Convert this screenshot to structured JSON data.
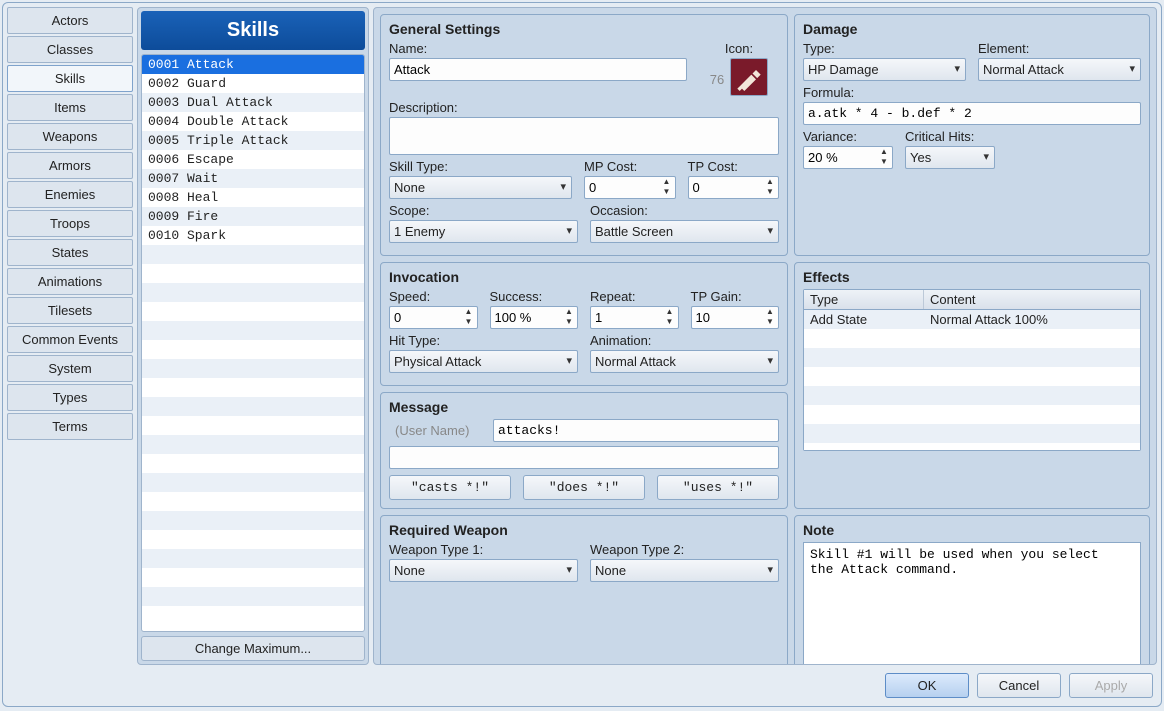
{
  "tabs": [
    "Actors",
    "Classes",
    "Skills",
    "Items",
    "Weapons",
    "Armors",
    "Enemies",
    "Troops",
    "States",
    "Animations",
    "Tilesets",
    "Common Events",
    "System",
    "Types",
    "Terms"
  ],
  "active_tab": 2,
  "list_header": "Skills",
  "skills": [
    "0001 Attack",
    "0002 Guard",
    "0003 Dual Attack",
    "0004 Double Attack",
    "0005 Triple Attack",
    "0006 Escape",
    "0007 Wait",
    "0008 Heal",
    "0009 Fire",
    "0010 Spark"
  ],
  "selected_skill": 0,
  "change_max": "Change Maximum...",
  "general": {
    "title": "General Settings",
    "name_label": "Name:",
    "name": "Attack",
    "icon_label": "Icon:",
    "icon_index": "76",
    "desc_label": "Description:",
    "desc": "",
    "skill_type_label": "Skill Type:",
    "skill_type": "None",
    "mp_cost_label": "MP Cost:",
    "mp_cost": "0",
    "tp_cost_label": "TP Cost:",
    "tp_cost": "0",
    "scope_label": "Scope:",
    "scope": "1 Enemy",
    "occasion_label": "Occasion:",
    "occasion": "Battle Screen"
  },
  "invocation": {
    "title": "Invocation",
    "speed_label": "Speed:",
    "speed": "0",
    "success_label": "Success:",
    "success": "100 %",
    "repeat_label": "Repeat:",
    "repeat": "1",
    "tp_gain_label": "TP Gain:",
    "tp_gain": "10",
    "hit_type_label": "Hit Type:",
    "hit_type": "Physical Attack",
    "animation_label": "Animation:",
    "animation": "Normal Attack"
  },
  "message": {
    "title": "Message",
    "user_placeholder": "(User Name)",
    "line1": "attacks!",
    "line2": "",
    "btn1": "\"casts *!\"",
    "btn2": "\"does *!\"",
    "btn3": "\"uses *!\""
  },
  "req_weapon": {
    "title": "Required Weapon",
    "w1_label": "Weapon Type 1:",
    "w1": "None",
    "w2_label": "Weapon Type 2:",
    "w2": "None"
  },
  "damage": {
    "title": "Damage",
    "type_label": "Type:",
    "type": "HP Damage",
    "element_label": "Element:",
    "element": "Normal Attack",
    "formula_label": "Formula:",
    "formula": "a.atk * 4 - b.def * 2",
    "variance_label": "Variance:",
    "variance": "20 %",
    "crit_label": "Critical Hits:",
    "crit": "Yes"
  },
  "effects": {
    "title": "Effects",
    "col_type": "Type",
    "col_content": "Content",
    "rows": [
      {
        "type": "Add State",
        "content": "Normal Attack 100%"
      }
    ]
  },
  "note": {
    "title": "Note",
    "text": "Skill #1 will be used when you select\nthe Attack command."
  },
  "footer": {
    "ok": "OK",
    "cancel": "Cancel",
    "apply": "Apply"
  }
}
